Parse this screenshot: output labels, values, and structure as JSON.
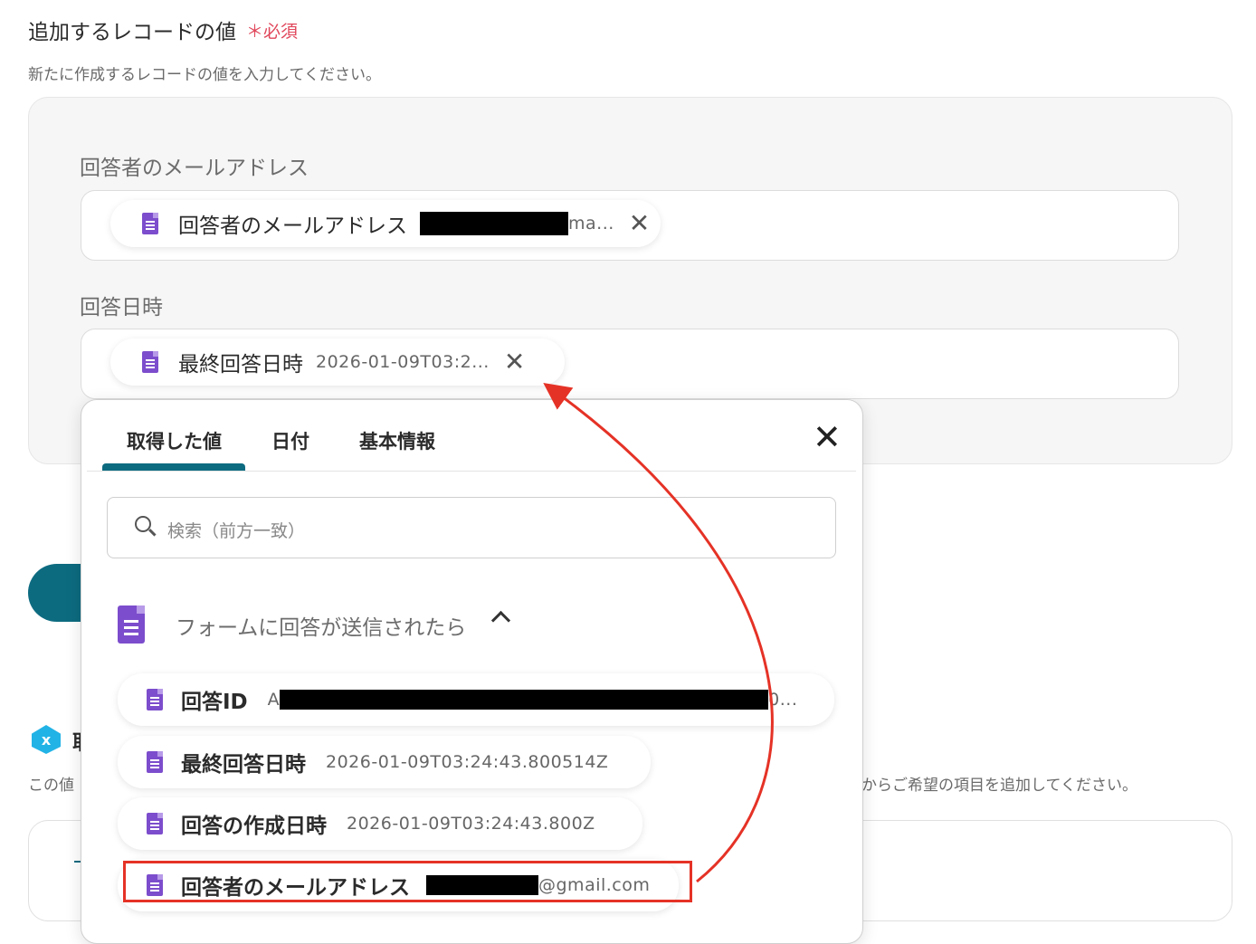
{
  "section": {
    "title": "追加するレコードの値",
    "required": "＊必須",
    "description": "新たに作成するレコードの値を入力してください。"
  },
  "fields": [
    {
      "label": "回答者のメールアドレス",
      "chip_label": "回答者のメールアドレス",
      "chip_value_suffix": "ma..."
    },
    {
      "label": "回答日時",
      "chip_label": "最終回答日時",
      "chip_value": "2026-01-09T03:2..."
    }
  ],
  "background": {
    "heading_char": "取",
    "desc_left": "この値",
    "desc_right": "からご希望の項目を追加してください。"
  },
  "popup": {
    "tabs": [
      "取得した値",
      "日付",
      "基本情報"
    ],
    "active_tab": 0,
    "search_placeholder": "検索（前方一致）",
    "group_label": "フォームに回答が送信されたら",
    "items": [
      {
        "label": "回答ID",
        "value_prefix": "A",
        "value_suffix": "0..."
      },
      {
        "label": "最終回答日時",
        "value": "2026-01-09T03:24:43.800514Z"
      },
      {
        "label": "回答の作成日時",
        "value": "2026-01-09T03:24:43.800Z"
      },
      {
        "label": "回答者のメールアドレス",
        "value_suffix": "@gmail.com"
      }
    ]
  },
  "colors": {
    "accent": "#0d6b80",
    "required": "#e0475b",
    "doc_icon": "#7c4dcc",
    "annotation": "#e53226"
  }
}
